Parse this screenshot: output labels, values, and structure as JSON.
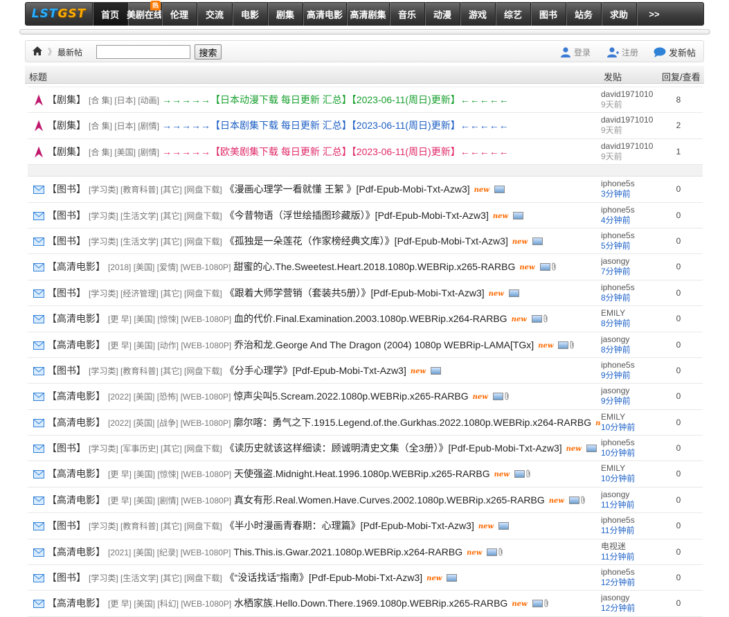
{
  "nav": {
    "logo_part1": "LST",
    "logo_part2": "GST",
    "items": [
      {
        "label": "首页",
        "active": true
      },
      {
        "label": "美剧在线",
        "badge": "热"
      },
      {
        "label": "伦理"
      },
      {
        "label": "交流"
      },
      {
        "label": "电影"
      },
      {
        "label": "剧集"
      },
      {
        "label": "高清电影"
      },
      {
        "label": "高清剧集"
      },
      {
        "label": "音乐"
      },
      {
        "label": "动漫"
      },
      {
        "label": "游戏"
      },
      {
        "label": "综艺"
      },
      {
        "label": "图书"
      },
      {
        "label": "站务"
      },
      {
        "label": "求助"
      },
      {
        "label": ">>"
      }
    ]
  },
  "toolbar": {
    "breadcrumb_sep": "》",
    "breadcrumb": "最新帖",
    "search_value": "",
    "search_label": "搜索",
    "login_label": "登录",
    "register_label": "注册",
    "newpost_label": "发新帖"
  },
  "list_header": {
    "title_col": "标题",
    "author_col": "发贴",
    "count_col": "回复/查看"
  },
  "pinned": [
    {
      "cat": "【剧集】",
      "tags": "[合 集] [日本] [动画]",
      "title": "→→→→→【日本动漫下载 每日更新 汇总】【2023-06-11(周日)更新】←←←←←",
      "color": "green",
      "author": "david1971010",
      "time": "9天前",
      "count": "8"
    },
    {
      "cat": "【剧集】",
      "tags": "[合 集] [日本] [剧情]",
      "title": "→→→→→【日本剧集下载 每日更新 汇总】【2023-06-11(周日)更新】←←←←←",
      "color": "blue",
      "author": "david1971010",
      "time": "9天前",
      "count": "2"
    },
    {
      "cat": "【剧集】",
      "tags": "[合 集] [美国] [剧情]",
      "title": "→→→→→【欧美剧集下载 每日更新 汇总】【2023-06-11(周日)更新】←←←←←",
      "color": "pink",
      "author": "david1971010",
      "time": "9天前",
      "count": "1"
    }
  ],
  "threads": [
    {
      "cat": "【图书】",
      "tags": "[学习类] [教育科普] [其它] [网盘下载]",
      "title": "《漫画心理学一看就懂 王絮 》[Pdf-Epub-Mobi-Txt-Azw3]",
      "new": "new",
      "clip": false,
      "author": "iphone5s",
      "time": "3分钟前",
      "count": "0"
    },
    {
      "cat": "【图书】",
      "tags": "[学习类] [生活文学] [其它] [网盘下载]",
      "title": "《今昔物语（浮世绘插图珍藏版）》[Pdf-Epub-Mobi-Txt-Azw3]",
      "new": "new",
      "clip": false,
      "author": "iphone5s",
      "time": "4分钟前",
      "count": "0"
    },
    {
      "cat": "【图书】",
      "tags": "[学习类] [生活文学] [其它] [网盘下载]",
      "title": "《孤独是一朵莲花（作家榜经典文库）》[Pdf-Epub-Mobi-Txt-Azw3]",
      "new": "new",
      "clip": false,
      "author": "iphone5s",
      "time": "5分钟前",
      "count": "0"
    },
    {
      "cat": "【高清电影】",
      "tags": "[2018] [美国] [爱情] [WEB-1080P]",
      "title": "甜蜜的心.The.Sweetest.Heart.2018.1080p.WEBRip.x265-RARBG",
      "new": "new",
      "clip": true,
      "author": "jasongy",
      "time": "7分钟前",
      "count": "0"
    },
    {
      "cat": "【图书】",
      "tags": "[学习类] [经济管理] [其它] [网盘下载]",
      "title": "《跟着大师学营销（套装共5册）》[Pdf-Epub-Mobi-Txt-Azw3]",
      "new": "new",
      "clip": false,
      "author": "iphone5s",
      "time": "8分钟前",
      "count": "0"
    },
    {
      "cat": "【高清电影】",
      "tags": "[更 早] [美国] [惊悚] [WEB-1080P]",
      "title": "血的代价.Final.Examination.2003.1080p.WEBRip.x264-RARBG",
      "new": "new",
      "clip": true,
      "author": "EMILY",
      "time": "8分钟前",
      "count": "0"
    },
    {
      "cat": "【高清电影】",
      "tags": "[更 早] [美国] [动作] [WEB-1080P]",
      "title": "乔治和龙.George And The Dragon (2004) 1080p WEBRip-LAMA[TGx]",
      "new": "new",
      "clip": true,
      "author": "jasongy",
      "time": "8分钟前",
      "count": "0"
    },
    {
      "cat": "【图书】",
      "tags": "[学习类] [教育科普] [其它] [网盘下载]",
      "title": "《分手心理学》[Pdf-Epub-Mobi-Txt-Azw3]",
      "new": "new",
      "clip": false,
      "author": "iphone5s",
      "time": "9分钟前",
      "count": "0"
    },
    {
      "cat": "【高清电影】",
      "tags": "[2022] [美国] [恐怖] [WEB-1080P]",
      "title": "惊声尖叫5.Scream.2022.1080p.WEBRip.x265-RARBG",
      "new": "new",
      "clip": true,
      "author": "jasongy",
      "time": "9分钟前",
      "count": "0"
    },
    {
      "cat": "【高清电影】",
      "tags": "[2022] [英国] [战争] [WEB-1080P]",
      "title": "廓尔喀：勇气之下.1915.Legend.of.the.Gurkhas.2022.1080p.WEBRip.x264-RARBG",
      "new": "new",
      "clip": true,
      "author": "EMILY",
      "time": "10分钟前",
      "count": "0"
    },
    {
      "cat": "【图书】",
      "tags": "[学习类] [军事历史] [其它] [网盘下载]",
      "title": "《读历史就该这样细读：顾诚明清史文集（全3册）》[Pdf-Epub-Mobi-Txt-Azw3]",
      "new": "new",
      "clip": false,
      "author": "iphone5s",
      "time": "10分钟前",
      "count": "0"
    },
    {
      "cat": "【高清电影】",
      "tags": "[更 早] [美国] [惊悚] [WEB-1080P]",
      "title": "天使强盗.Midnight.Heat.1996.1080p.WEBRip.x265-RARBG",
      "new": "new",
      "clip": true,
      "author": "EMILY",
      "time": "10分钟前",
      "count": "0"
    },
    {
      "cat": "【高清电影】",
      "tags": "[更 早] [美国] [剧情] [WEB-1080P]",
      "title": "真女有形.Real.Women.Have.Curves.2002.1080p.WEBRip.x265-RARBG",
      "new": "new",
      "clip": true,
      "author": "jasongy",
      "time": "11分钟前",
      "count": "0"
    },
    {
      "cat": "【图书】",
      "tags": "[学习类] [教育科普] [其它] [网盘下载]",
      "title": "《半小时漫画青春期：心理篇》[Pdf-Epub-Mobi-Txt-Azw3]",
      "new": "new",
      "clip": false,
      "author": "iphone5s",
      "time": "11分钟前",
      "count": "0"
    },
    {
      "cat": "【高清电影】",
      "tags": "[2021] [美国] [纪录] [WEB-1080P]",
      "title": "This.This.is.Gwar.2021.1080p.WEBRip.x264-RARBG",
      "new": "new",
      "clip": true,
      "author": "电视迷",
      "time": "11分钟前",
      "count": "0"
    },
    {
      "cat": "【图书】",
      "tags": "[学习类] [生活文学] [其它] [网盘下载]",
      "title": "《“没话找话”指南》[Pdf-Epub-Mobi-Txt-Azw3]",
      "new": "new",
      "clip": false,
      "author": "iphone5s",
      "time": "12分钟前",
      "count": "0"
    },
    {
      "cat": "【高清电影】",
      "tags": "[更 早] [美国] [科幻] [WEB-1080P]",
      "title": "水栖家族.Hello.Down.There.1969.1080p.WEBRip.x265-RARBG",
      "new": "new",
      "clip": true,
      "author": "jasongy",
      "time": "12分钟前",
      "count": "0"
    }
  ],
  "colors": {
    "green": "#18a02f",
    "blue": "#1e5fc4",
    "pink": "#e02a6a",
    "time_link": "#1e62c8",
    "new_tag": "#ff6a00",
    "pinned_arrow": "#c0186e",
    "mail_icon": "#2f7fd6"
  },
  "icons": {
    "home": "home-icon",
    "login": "user-icon",
    "register": "user-add-icon",
    "newpost": "speech-bubble-icon",
    "pinned": "pin-arrow-icon",
    "thread": "mail-icon",
    "image": "image-icon",
    "attachment": "paperclip-icon"
  }
}
